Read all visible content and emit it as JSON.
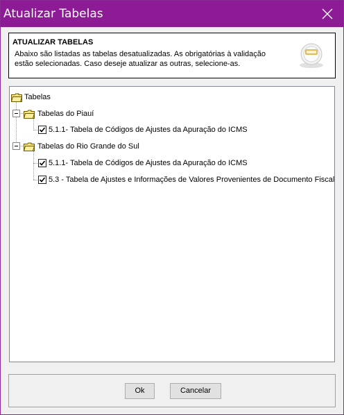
{
  "window": {
    "title": "Atualizar Tabelas",
    "close_icon": "close-icon"
  },
  "header": {
    "title": "ATUALIZAR TABELAS",
    "line1": "Abaixo são listadas as tabelas desatualizadas. As obrigatórias à  validação",
    "line2": "estão selecionadas. Caso deseje atualizar as outras, selecione-as.",
    "icon": "database-globe-icon"
  },
  "tree": {
    "root": "Tabelas",
    "groups": [
      {
        "label": "Tabelas do Piauí",
        "items": [
          {
            "label": "5.1.1- Tabela de Códigos de Ajustes da Apuração do ICMS",
            "checked": true
          }
        ]
      },
      {
        "label": "Tabelas do Rio Grande do Sul",
        "items": [
          {
            "label": "5.1.1- Tabela de Códigos de Ajustes da Apuração do ICMS",
            "checked": true
          },
          {
            "label": "5.3 - Tabela de Ajustes e Informações de Valores Provenientes de Documento Fiscal",
            "checked": true
          }
        ]
      }
    ]
  },
  "buttons": {
    "ok": "Ok",
    "cancel": "Cancelar"
  },
  "colors": {
    "titlebar": "#8e1b96",
    "folder": "#f5e27a"
  }
}
